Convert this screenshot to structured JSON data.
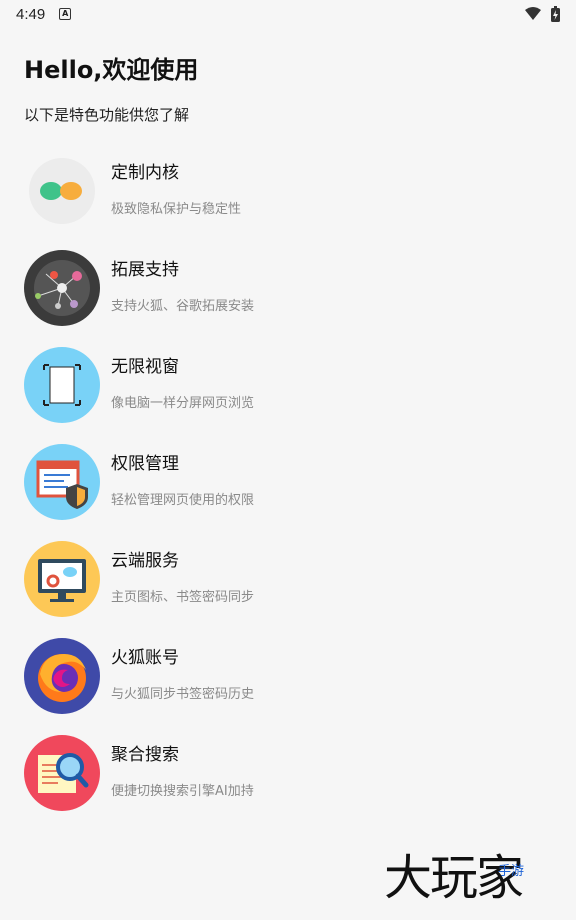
{
  "status_bar": {
    "time": "4:49",
    "notification_letter": "A",
    "icons": [
      "wifi-icon",
      "battery-charging-icon"
    ]
  },
  "header": {
    "greeting": "Hello,欢迎使用",
    "subtitle": "以下是特色功能供您了解"
  },
  "features": [
    {
      "title": "定制内核",
      "desc": "极致隐私保护与稳定性",
      "icon": "kernel-icon",
      "color": "#ececec"
    },
    {
      "title": "拓展支持",
      "desc": "支持火狐、谷歌拓展安装",
      "icon": "extension-network-icon",
      "color": "#3b3b3b"
    },
    {
      "title": "无限视窗",
      "desc": "像电脑一样分屏网页浏览",
      "icon": "window-icon",
      "color": "#79d2f7"
    },
    {
      "title": "权限管理",
      "desc": "轻松管理网页使用的权限",
      "icon": "permission-shield-icon",
      "color": "#79d2f7"
    },
    {
      "title": "云端服务",
      "desc": "主页图标、书签密码同步",
      "icon": "cloud-monitor-icon",
      "color": "#fdc856"
    },
    {
      "title": "火狐账号",
      "desc": "与火狐同步书签密码历史",
      "icon": "firefox-icon",
      "color": "#3f4aa8"
    },
    {
      "title": "聚合搜索",
      "desc": "便捷切换搜索引擎AI加持",
      "icon": "search-document-icon",
      "color": "#f0485c"
    }
  ],
  "watermark": {
    "text": "大玩家",
    "sub": "手游"
  }
}
